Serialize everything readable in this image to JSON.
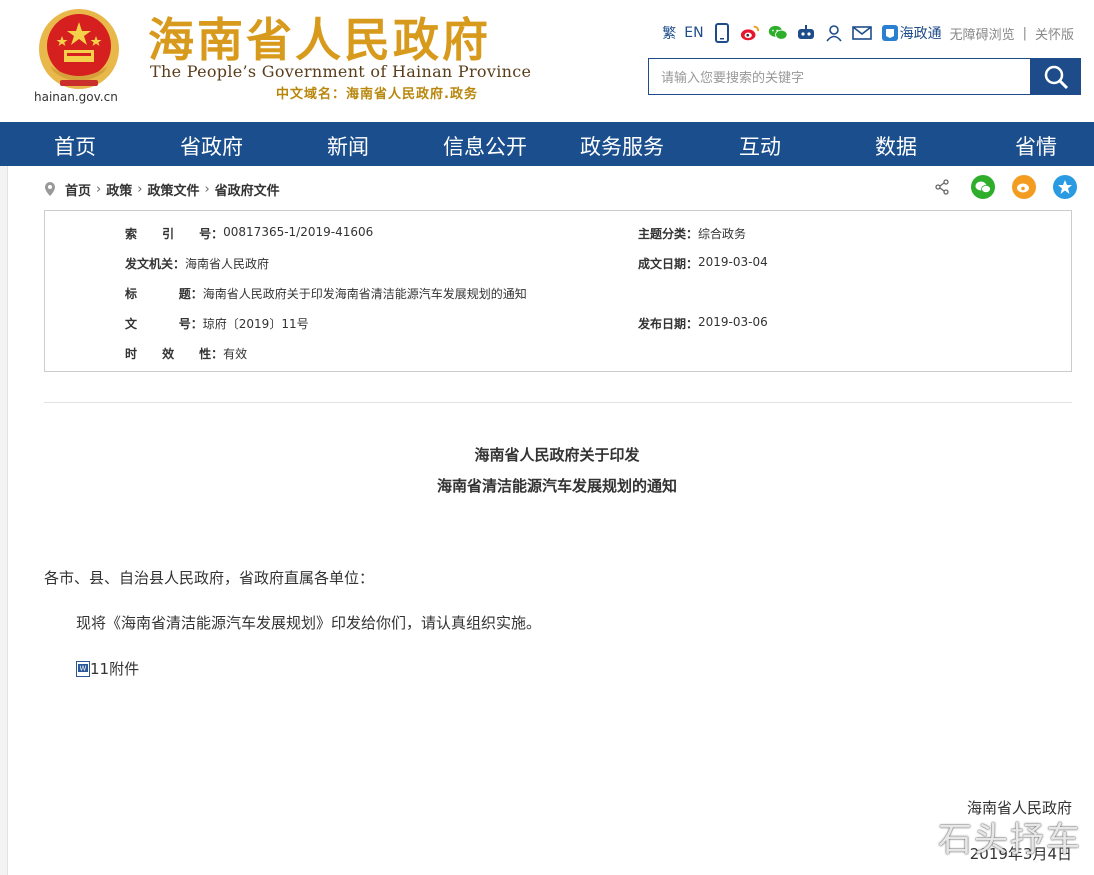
{
  "header": {
    "site_name_cn": "海南省人民政府",
    "site_name_en": "The People’s Government  of Hainan Province",
    "domain_cn": "中文域名：海南省人民政府.政务",
    "logo_domain": "hainan.gov.cn",
    "toolbar": {
      "traditional": "繁",
      "english": "EN",
      "hzt": "海政通",
      "accessible": "无障碍浏览",
      "separator": "|",
      "care": "关怀版"
    },
    "search": {
      "placeholder": "请输入您要搜索的关键字"
    }
  },
  "nav": {
    "items": [
      "首页",
      "省政府",
      "新闻",
      "信息公开",
      "政务服务",
      "互动",
      "数据",
      "省情"
    ]
  },
  "breadcrumb": {
    "items": [
      "首页",
      "政策",
      "政策文件",
      "省政府文件"
    ],
    "sep": "›"
  },
  "info": {
    "index_label": "索      引      号：",
    "index_value": "00817365-1/2019-41606",
    "topic_label": "主题分类：",
    "topic_value": "综合政务",
    "issuer_label": "发文机关：",
    "issuer_value": "海南省人民政府",
    "created_label": "成文日期：",
    "created_value": "2019-03-04",
    "title_label": "标          题：",
    "title_value": "海南省人民政府关于印发海南省清洁能源汽车发展规划的通知",
    "docno_label": "文          号：",
    "docno_value": "琼府〔2019〕11号",
    "published_label": "发布日期：",
    "published_value": "2019-03-06",
    "validity_label": "时      效      性：",
    "validity_value": "有效"
  },
  "document": {
    "title_line1": "海南省人民政府关于印发",
    "title_line2": "海南省清洁能源汽车发展规划的通知",
    "salutation": "各市、县、自治县人民政府，省政府直属各单位：",
    "paragraph1": "现将《海南省清洁能源汽车发展规划》印发给你们，请认真组织实施。",
    "attachment": "11附件",
    "sign_org": "海南省人民政府",
    "sign_date": "2019年3月4日"
  },
  "watermark": "石头抒车",
  "colors": {
    "nav_bg": "#1b4e8c",
    "title_gold": "#d89a1c",
    "link_blue": "#1e4c8a"
  }
}
